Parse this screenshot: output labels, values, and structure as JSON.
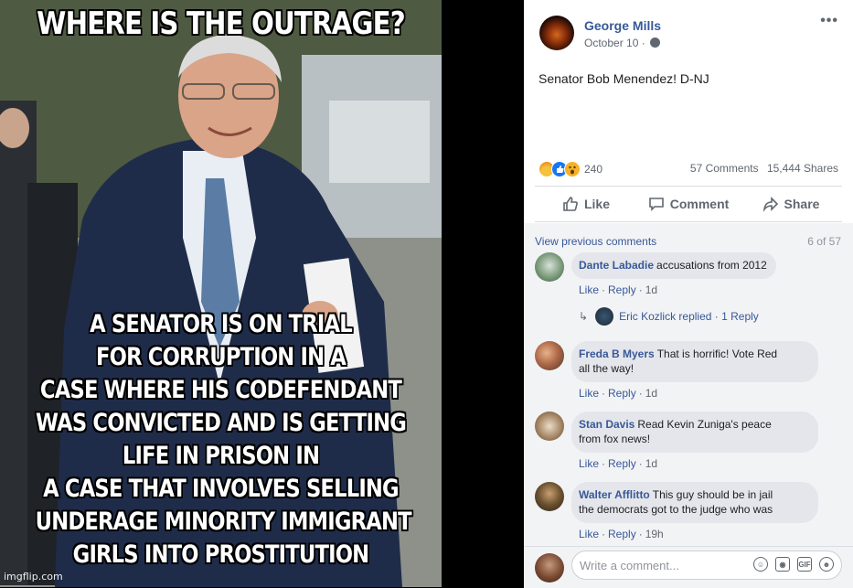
{
  "meme": {
    "top_text": "WHERE IS THE OUTRAGE?",
    "bottom_lines": [
      "A SENATOR IS ON TRIAL",
      "FOR CORRUPTION IN A",
      "CASE WHERE HIS CODEFENDANT",
      "WAS CONVICTED AND IS GETTING",
      "LIFE IN PRISON IN",
      "A CASE THAT INVOLVES SELLING",
      "UNDERAGE MINORITY IMMIGRANT",
      "GIRLS INTO PROSTITUTION"
    ],
    "watermark": "imgflip.com"
  },
  "post": {
    "author": "George Mills",
    "date": "October 10 · ",
    "more_glyph": "•••",
    "text": "Senator Bob Menendez! D-NJ",
    "reaction_count": "240",
    "comments_count": "57 Comments",
    "shares_count": "15,444 Shares"
  },
  "actions": {
    "like": "Like",
    "comment": "Comment",
    "share": "Share"
  },
  "comments_header": {
    "view_previous": "View previous comments",
    "of_count": "6 of 57"
  },
  "comments": [
    {
      "name": "Dante Labadie",
      "text": "accusations from 2012",
      "like": "Like",
      "reply": "Reply",
      "time": "1d"
    },
    {
      "name": "Freda B Myers",
      "text": "That is horrific! Vote Red",
      "text2": "all the way!",
      "like": "Like",
      "reply": "Reply",
      "time": "1d"
    },
    {
      "name": "Stan Davis",
      "text": "Read Kevin Zuniga's peace",
      "text2": "from fox news!",
      "like": "Like",
      "reply": "Reply",
      "time": "1d"
    },
    {
      "name": "Walter Afflitto",
      "text": "This guy should be in jail",
      "text2": "the democrats got to the judge who was",
      "like": "Like",
      "reply": "Reply",
      "time": "19h"
    }
  ],
  "reply_thread": {
    "text": "Eric Kozlick replied · 1 Reply"
  },
  "write_comment": {
    "placeholder": "Write a comment...",
    "icons": [
      "emoji-icon",
      "camera-icon",
      "gif-icon",
      "sticker-icon"
    ]
  },
  "colors": {
    "link": "#385898",
    "muted": "#606770",
    "bubble": "#e4e6eb",
    "panel_bg": "#f2f3f5"
  }
}
